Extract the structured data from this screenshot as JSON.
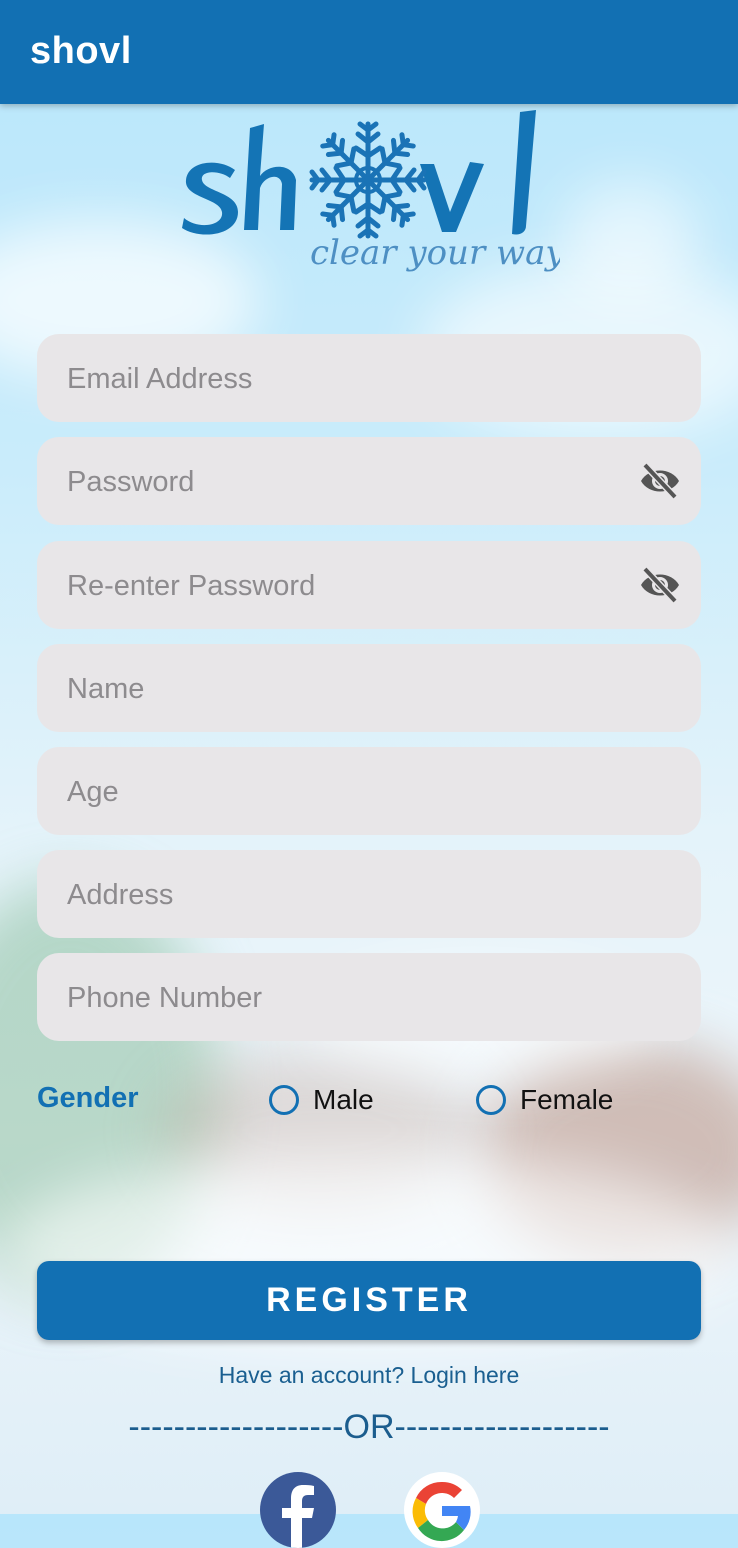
{
  "app_bar": {
    "title": "shovl"
  },
  "logo": {
    "brand": "shovl",
    "tagline": "clear your way"
  },
  "form": {
    "email": {
      "placeholder": "Email Address",
      "value": ""
    },
    "password": {
      "placeholder": "Password",
      "value": ""
    },
    "confirm_password": {
      "placeholder": "Re-enter Password",
      "value": ""
    },
    "name": {
      "placeholder": "Name",
      "value": ""
    },
    "age": {
      "placeholder": "Age",
      "value": ""
    },
    "address": {
      "placeholder": "Address",
      "value": ""
    },
    "phone": {
      "placeholder": "Phone Number",
      "value": ""
    }
  },
  "gender": {
    "label": "Gender",
    "options": [
      {
        "label": "Male",
        "selected": false
      },
      {
        "label": "Female",
        "selected": false
      }
    ]
  },
  "actions": {
    "register_label": "REGISTER",
    "login_prompt": "Have an account? Login here",
    "separator": "-------------------OR-------------------"
  },
  "social": {
    "facebook_icon": "facebook-icon",
    "google_icon": "google-icon"
  },
  "colors": {
    "primary": "#1270b3",
    "field_bg": "#e8e6e8",
    "placeholder": "#8d8b8e"
  }
}
